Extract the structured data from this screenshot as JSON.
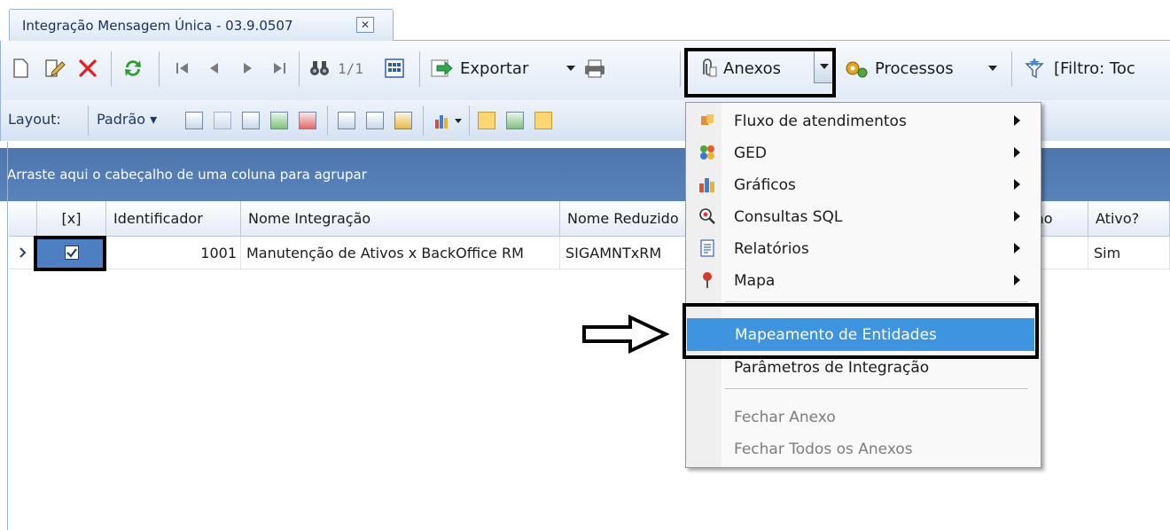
{
  "tab": {
    "title": "Integração Mensagem Única - 03.9.0507",
    "close": "✕"
  },
  "toolbar": {
    "page_indicator": "1/1",
    "export_label": "Exportar",
    "anexos_label": "Anexos",
    "processos_label": "Processos",
    "filter_label": "[Filtro: Toc"
  },
  "layout_bar": {
    "label": "Layout:",
    "preset": "Padrão"
  },
  "group_panel": {
    "text": "Arraste aqui o cabeçalho de uma coluna para agrupar"
  },
  "grid": {
    "columns": [
      "[x]",
      "Identificador",
      "Nome Integração",
      "Nome Reduzido",
      "ão",
      "Ativo?"
    ],
    "row": {
      "checked": true,
      "identificador": "1001",
      "nome_integracao": "Manutenção de Ativos x BackOffice RM",
      "nome_reduzido": "SIGAMNTxRM",
      "ativo": "Sim"
    }
  },
  "menu": {
    "items": [
      {
        "label": "Fluxo de atendimentos",
        "icon": "flow-icon",
        "submenu": true
      },
      {
        "label": "GED",
        "icon": "ged-icon",
        "submenu": true
      },
      {
        "label": "Gráficos",
        "icon": "chart-icon",
        "submenu": true
      },
      {
        "label": "Consultas SQL",
        "icon": "sql-query-icon",
        "submenu": true
      },
      {
        "label": "Relatórios",
        "icon": "report-icon",
        "submenu": true
      },
      {
        "label": "Mapa",
        "icon": "map-pin-icon",
        "submenu": true
      },
      {
        "label": "Mapeamento de Entidades",
        "selected": true
      },
      {
        "label": "Parâmetros de Integração"
      },
      {
        "label": "Fechar Anexo",
        "disabled": true
      },
      {
        "label": "Fechar Todos os Anexos",
        "disabled": true
      }
    ]
  },
  "colors": {
    "selection": "#3f94e0",
    "group_panel": "#5983bb",
    "highlight_box": "#000000"
  }
}
